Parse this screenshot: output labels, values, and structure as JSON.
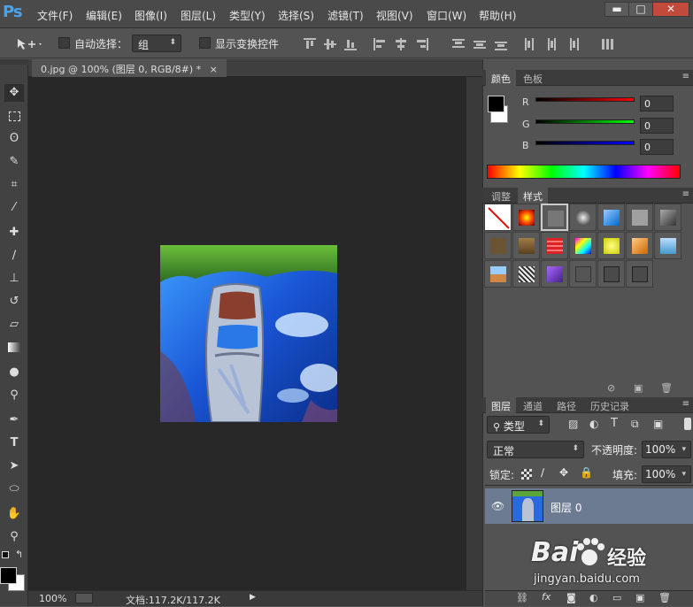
{
  "app": {
    "logo": "Ps"
  },
  "menu": [
    "文件(F)",
    "编辑(E)",
    "图像(I)",
    "图层(L)",
    "类型(Y)",
    "选择(S)",
    "滤镜(T)",
    "视图(V)",
    "窗口(W)",
    "帮助(H)"
  ],
  "window_buttons": {
    "minimize": "▬",
    "restore": "□",
    "close": "✕"
  },
  "options": {
    "auto_select_label": "自动选择：",
    "auto_select_value": "组",
    "show_transform_label": "显示变换控件"
  },
  "document": {
    "tab_title": "0.jpg @ 100% (图层 0, RGB/8#) *",
    "tab_close": "×"
  },
  "status": {
    "zoom": "100%",
    "doc_info": "文档:117.2K/117.2K"
  },
  "color_panel": {
    "tabs": [
      "颜色",
      "色板"
    ],
    "channels": [
      {
        "name": "R",
        "value": "0",
        "color": "#d01b1b"
      },
      {
        "name": "G",
        "value": "0",
        "color": "#1cbd1c"
      },
      {
        "name": "B",
        "value": "0",
        "color": "#1b2dd0"
      }
    ]
  },
  "styles_panel": {
    "tabs": [
      "调整",
      "样式"
    ]
  },
  "layers_panel": {
    "tabs": [
      "图层",
      "通道",
      "路径",
      "历史记录"
    ],
    "filter_label": "类型",
    "blend_mode": "正常",
    "opacity_label": "不透明度:",
    "opacity_value": "100%",
    "lock_label": "锁定:",
    "fill_label": "填充:",
    "fill_value": "100%",
    "layer_name": "图层 0"
  },
  "watermark": {
    "brand": "Bai",
    "brand2": "经验",
    "url": "jingyan.baidu.com"
  }
}
